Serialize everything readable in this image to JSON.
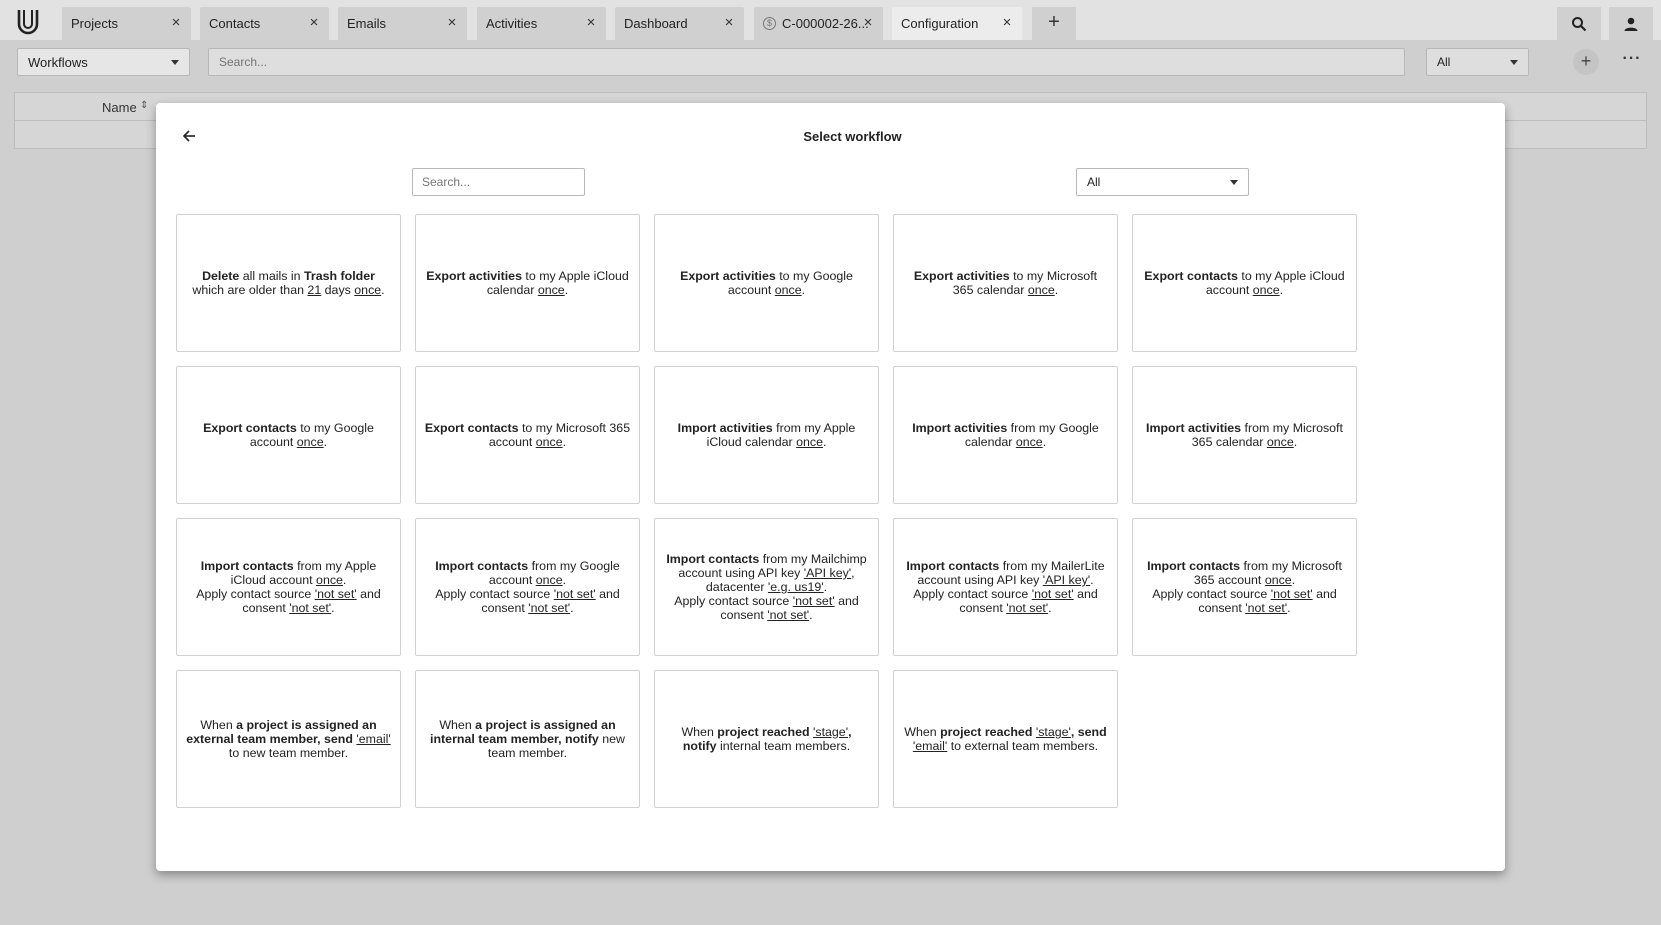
{
  "tabs": [
    {
      "label": "Projects"
    },
    {
      "label": "Contacts"
    },
    {
      "label": "Emails"
    },
    {
      "label": "Activities"
    },
    {
      "label": "Dashboard"
    },
    {
      "label": "C-000002-26...",
      "icon": "currency-icon"
    },
    {
      "label": "Configuration",
      "active": true
    }
  ],
  "toolbar": {
    "module_select": "Workflows",
    "search_placeholder": "Search...",
    "filter": "All"
  },
  "table": {
    "name_header": "Name"
  },
  "modal": {
    "title": "Select workflow",
    "search_placeholder": "Search...",
    "filter": "All",
    "cards": [
      [
        {
          "b": "Delete"
        },
        {
          "t": " all mails in "
        },
        {
          "b": "Trash folder"
        },
        {
          "t": " which are older than "
        },
        {
          "u": "21"
        },
        {
          "t": " days "
        },
        {
          "u": "once"
        },
        {
          "t": "."
        }
      ],
      [
        {
          "b": "Export activities"
        },
        {
          "t": " to my Apple iCloud calendar "
        },
        {
          "u": "once"
        },
        {
          "t": "."
        }
      ],
      [
        {
          "b": "Export activities"
        },
        {
          "t": " to my Google account "
        },
        {
          "u": "once"
        },
        {
          "t": "."
        }
      ],
      [
        {
          "b": "Export activities"
        },
        {
          "t": " to my Microsoft 365 calendar "
        },
        {
          "u": "once"
        },
        {
          "t": "."
        }
      ],
      [
        {
          "b": "Export contacts"
        },
        {
          "t": " to my Apple iCloud account "
        },
        {
          "u": "once"
        },
        {
          "t": "."
        }
      ],
      [
        {
          "b": "Export contacts"
        },
        {
          "t": " to my Google account "
        },
        {
          "u": "once"
        },
        {
          "t": "."
        }
      ],
      [
        {
          "b": "Export contacts"
        },
        {
          "t": " to my Microsoft 365 account "
        },
        {
          "u": "once"
        },
        {
          "t": "."
        }
      ],
      [
        {
          "b": "Import activities"
        },
        {
          "t": " from my Apple iCloud calendar "
        },
        {
          "u": "once"
        },
        {
          "t": "."
        }
      ],
      [
        {
          "b": "Import activities"
        },
        {
          "t": " from my Google calendar "
        },
        {
          "u": "once"
        },
        {
          "t": "."
        }
      ],
      [
        {
          "b": "Import activities"
        },
        {
          "t": " from my Microsoft 365 calendar "
        },
        {
          "u": "once"
        },
        {
          "t": "."
        }
      ],
      [
        {
          "b": "Import contacts"
        },
        {
          "t": " from my Apple iCloud account "
        },
        {
          "u": "once"
        },
        {
          "t": "."
        },
        {
          "br": true
        },
        {
          "t": "Apply contact source "
        },
        {
          "u": "'not set'"
        },
        {
          "t": " and consent "
        },
        {
          "u": "'not set'"
        },
        {
          "t": "."
        }
      ],
      [
        {
          "b": "Import contacts"
        },
        {
          "t": " from my Google account "
        },
        {
          "u": "once"
        },
        {
          "t": "."
        },
        {
          "br": true
        },
        {
          "t": "Apply contact source "
        },
        {
          "u": "'not set'"
        },
        {
          "t": " and consent "
        },
        {
          "u": "'not set'"
        },
        {
          "t": "."
        }
      ],
      [
        {
          "b": "Import contacts"
        },
        {
          "t": " from my Mailchimp account using API key "
        },
        {
          "u": "'API key'"
        },
        {
          "t": ", datacenter "
        },
        {
          "u": "'e.g. us19'"
        },
        {
          "t": "."
        },
        {
          "br": true
        },
        {
          "t": "Apply contact source "
        },
        {
          "u": "'not set'"
        },
        {
          "t": " and consent "
        },
        {
          "u": "'not set'"
        },
        {
          "t": "."
        }
      ],
      [
        {
          "b": "Import contacts"
        },
        {
          "t": " from my MailerLite account using API key "
        },
        {
          "u": "'API key'"
        },
        {
          "t": "."
        },
        {
          "br": true
        },
        {
          "t": "Apply contact source "
        },
        {
          "u": "'not set'"
        },
        {
          "t": " and consent "
        },
        {
          "u": "'not set'"
        },
        {
          "t": "."
        }
      ],
      [
        {
          "b": "Import contacts"
        },
        {
          "t": " from my Microsoft 365 account "
        },
        {
          "u": "once"
        },
        {
          "t": "."
        },
        {
          "br": true
        },
        {
          "t": "Apply contact source "
        },
        {
          "u": "'not set'"
        },
        {
          "t": " and consent "
        },
        {
          "u": "'not set'"
        },
        {
          "t": "."
        }
      ],
      [
        {
          "t": "When "
        },
        {
          "b": "a project is assigned an external team member, send "
        },
        {
          "u": "'email'"
        },
        {
          "t": " to new team member."
        }
      ],
      [
        {
          "t": "When "
        },
        {
          "b": "a project is assigned an internal team member, notify"
        },
        {
          "t": " new team member."
        }
      ],
      [
        {
          "t": "When "
        },
        {
          "b": "project reached "
        },
        {
          "u": "'stage'"
        },
        {
          "b": ", notify"
        },
        {
          "t": " internal team members."
        }
      ],
      [
        {
          "t": "When "
        },
        {
          "b": "project reached "
        },
        {
          "u": "'stage'"
        },
        {
          "b": ", send"
        },
        {
          "t": " "
        },
        {
          "u": "'email'"
        },
        {
          "t": " to external team members."
        }
      ]
    ]
  }
}
